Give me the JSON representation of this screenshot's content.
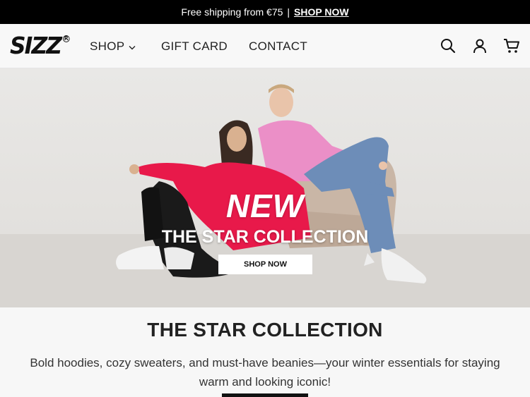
{
  "announcement": {
    "text": "Free shipping from €75",
    "separator": "|",
    "link": "SHOP NOW"
  },
  "header": {
    "logo": "SIZZ",
    "logo_mark": "R",
    "nav": [
      {
        "label": "SHOP",
        "has_dropdown": true
      },
      {
        "label": "GIFT CARD"
      },
      {
        "label": "CONTACT"
      }
    ],
    "icons": [
      "search-icon",
      "account-icon",
      "cart-icon"
    ]
  },
  "hero": {
    "headline": "NEW",
    "subheadline": "THE STAR COLLECTION",
    "button": "SHOP NOW"
  },
  "section": {
    "title": "THE STAR COLLECTION",
    "description": "Bold hoodies, cozy sweaters, and must-have beanies—your winter essentials for staying warm and looking iconic!"
  }
}
